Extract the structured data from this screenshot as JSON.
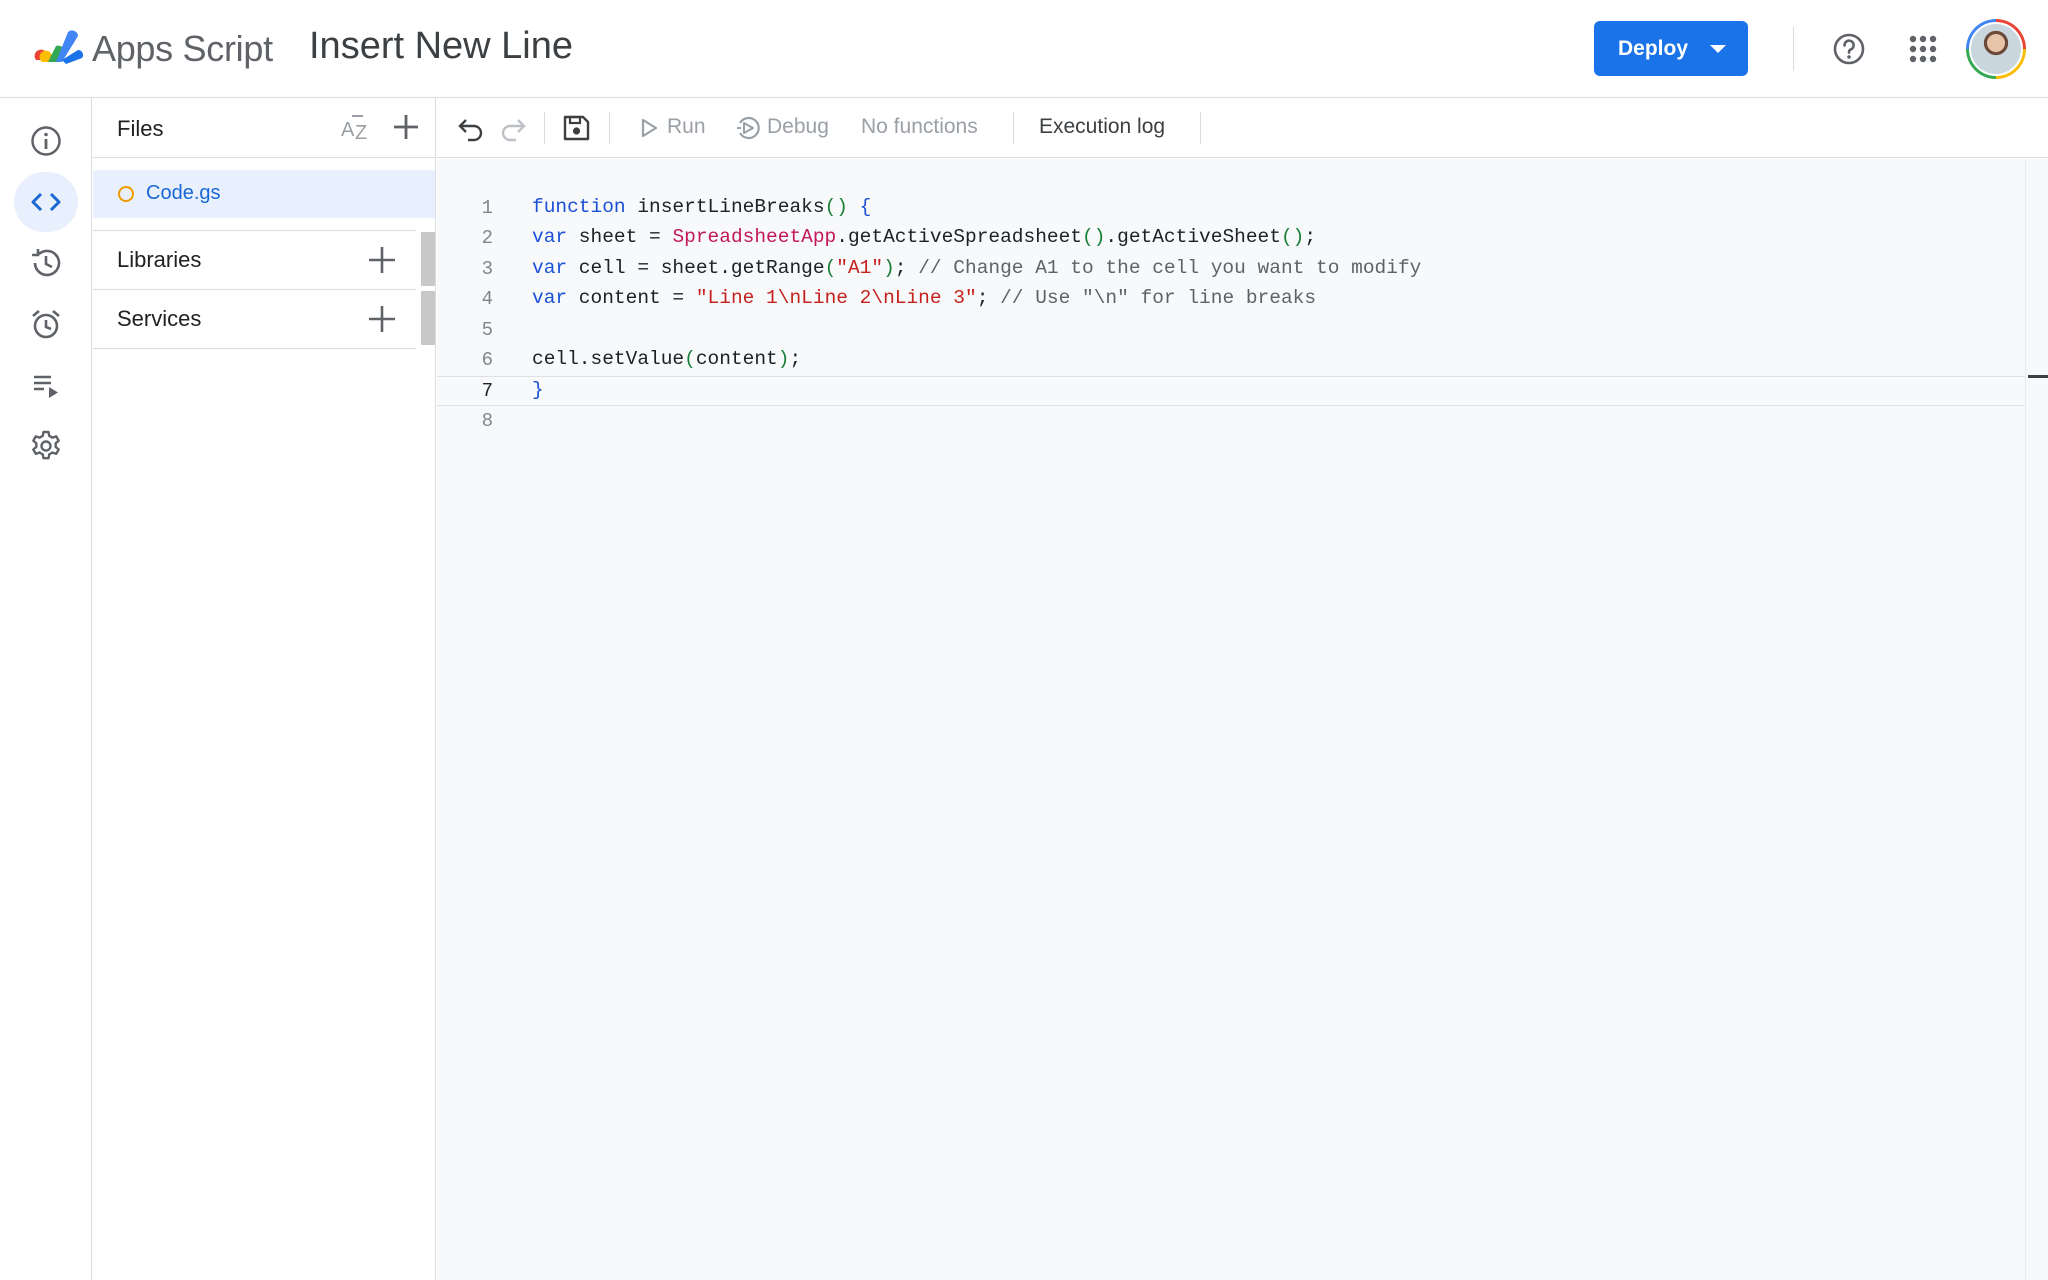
{
  "header": {
    "app_name": "Apps Script",
    "project_title": "Insert New Line",
    "deploy_label": "Deploy"
  },
  "rail": {
    "items": [
      {
        "icon": "info-icon",
        "label": "Overview"
      },
      {
        "icon": "code-icon",
        "label": "Editor",
        "active": true
      },
      {
        "icon": "history-icon",
        "label": "Project history"
      },
      {
        "icon": "alarm-icon",
        "label": "Triggers"
      },
      {
        "icon": "executions-icon",
        "label": "Executions"
      },
      {
        "icon": "gear-icon",
        "label": "Project Settings"
      }
    ]
  },
  "files_panel": {
    "title": "Files",
    "files": [
      {
        "name": "Code.gs",
        "selected": true
      }
    ],
    "sections": [
      {
        "label": "Libraries"
      },
      {
        "label": "Services"
      }
    ]
  },
  "toolbar": {
    "run_label": "Run",
    "debug_label": "Debug",
    "function_select": "No functions",
    "execution_log_label": "Execution log"
  },
  "editor": {
    "current_line": 7,
    "line_numbers": [
      "1",
      "2",
      "3",
      "4",
      "5",
      "6",
      "7",
      "8"
    ],
    "lines": [
      "function insertLineBreaks() {",
      "var sheet = SpreadsheetApp.getActiveSpreadsheet().getActiveSheet();",
      "var cell = sheet.getRange(\"A1\"); // Change A1 to the cell you want to modify",
      "var content = \"Line 1\\nLine 2\\nLine 3\"; // Use \"\\n\" for line breaks",
      "",
      "cell.setValue(content);",
      "}",
      ""
    ]
  },
  "colors": {
    "accent": "#1a73e8",
    "keyword": "#1a4fd6",
    "class": "#c2185b",
    "string": "#c5221f",
    "comment": "#5f6368",
    "paren": "#188038",
    "file_modified_dot": "#f29900"
  }
}
